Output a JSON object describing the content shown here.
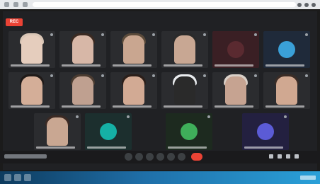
{
  "recording": {
    "label": "REC"
  },
  "colors": {
    "accent_red": "#ea4335",
    "tile_bg": "#2b2c2f",
    "background": "#202124"
  },
  "icons": {
    "browser": [
      "back-icon",
      "forward-icon",
      "reload-icon",
      "extensions-icon",
      "profile-icon",
      "menu-icon"
    ],
    "controls": [
      "mic-icon",
      "camera-icon",
      "captions-icon",
      "raise-hand-icon",
      "present-icon",
      "more-icon",
      "end-call-icon"
    ],
    "right": [
      "info-icon",
      "people-icon",
      "chat-icon",
      "activities-icon"
    ]
  }
}
